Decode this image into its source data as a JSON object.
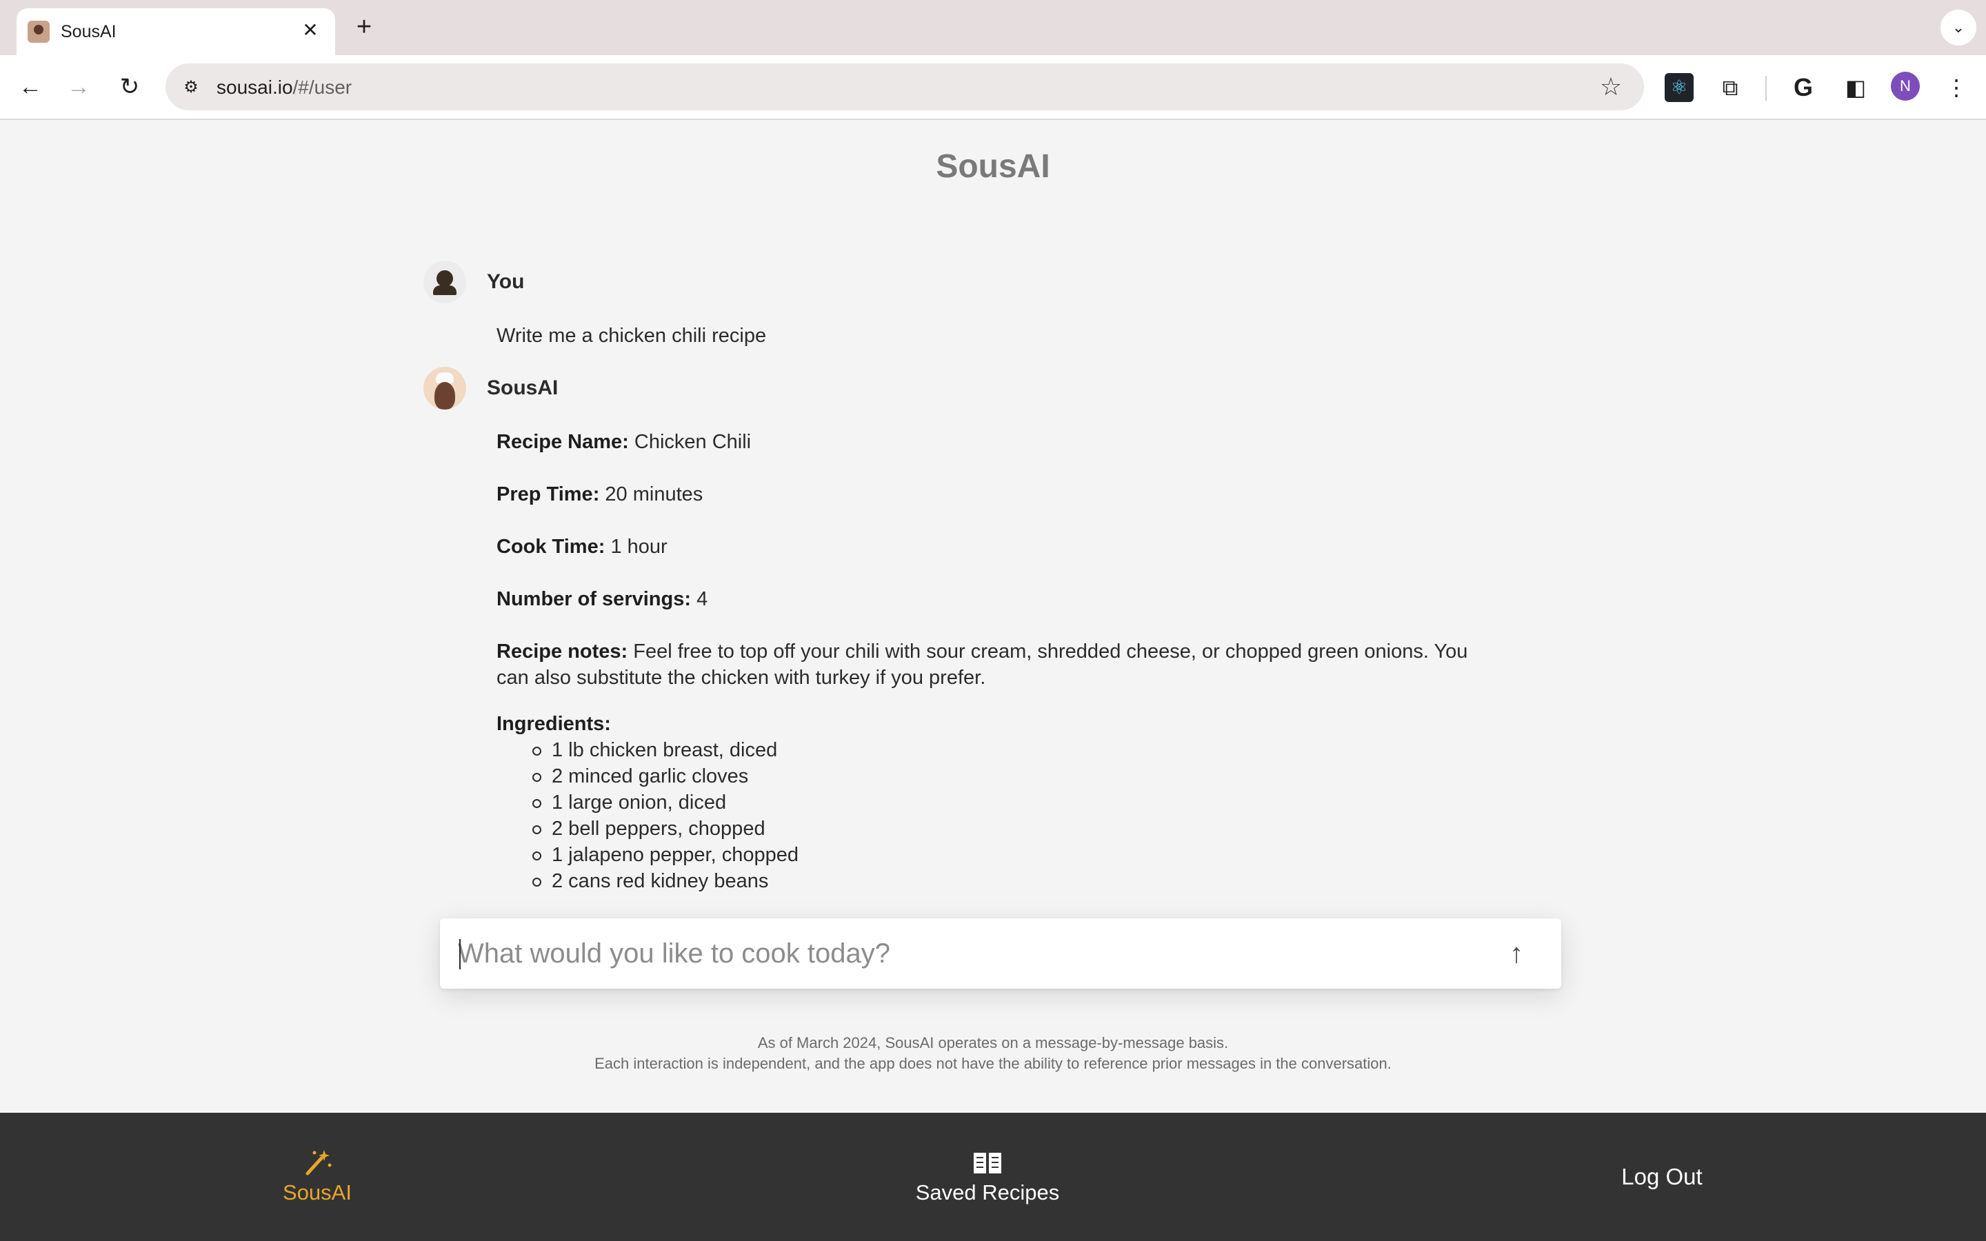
{
  "browser": {
    "tab_title": "SousAI",
    "url_host": "sousai.io",
    "url_path": "/#/user",
    "profile_initial": "N"
  },
  "app": {
    "title": "SousAI"
  },
  "conversation": {
    "user": {
      "name": "You",
      "message": "Write me a chicken chili recipe"
    },
    "assistant": {
      "name": "SousAI",
      "recipe_name_label": "Recipe Name:",
      "recipe_name": "Chicken Chili",
      "prep_time_label": "Prep Time:",
      "prep_time": "20 minutes",
      "cook_time_label": "Cook Time:",
      "cook_time": "1 hour",
      "servings_label": "Number of servings:",
      "servings": "4",
      "notes_label": "Recipe notes:",
      "notes": "Feel free to top off your chili with sour cream, shredded cheese, or chopped green onions. You can also substitute the chicken with turkey if you prefer.",
      "ingredients_label": "Ingredients:",
      "ingredients": [
        "1 lb chicken breast, diced",
        "2 minced garlic cloves",
        "1 large onion, diced",
        "2 bell peppers, chopped",
        "1 jalapeno pepper, chopped",
        "2 cans red kidney beans"
      ]
    }
  },
  "composer": {
    "placeholder": "What would you like to cook today?"
  },
  "disclaimer": {
    "line1": "As of March 2024, SousAI operates on a message-by-message basis.",
    "line2": "Each interaction is independent, and the app does not have the ability to reference prior messages in the conversation."
  },
  "bottom_nav": {
    "sousai_label": "SousAI",
    "saved_label": "Saved Recipes",
    "logout_label": "Log Out"
  },
  "colors": {
    "accent": "#e8a72c",
    "nav_bg": "#333333",
    "page_bg": "#f4f4f4"
  }
}
